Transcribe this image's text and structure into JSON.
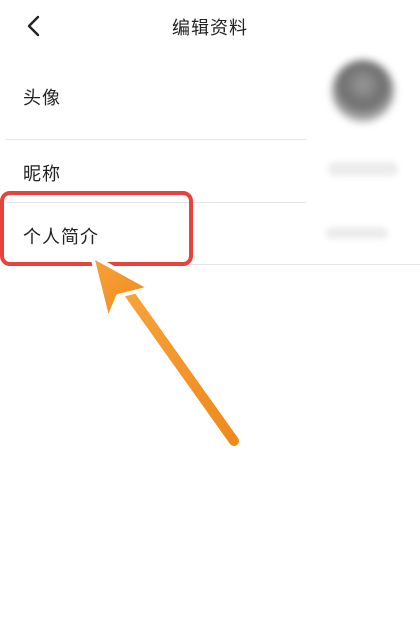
{
  "header": {
    "title": "编辑资料"
  },
  "rows": {
    "avatar": {
      "label": "头像"
    },
    "nickname": {
      "label": "昵称"
    },
    "bio": {
      "label": "个人简介"
    }
  },
  "colors": {
    "highlight": "#e8423d",
    "arrow": "#f39324",
    "text": "#222222",
    "divider": "#e6e6e6"
  },
  "icons": {
    "back": "chevron-left-icon",
    "pointer": "arrow-pointer-icon"
  }
}
